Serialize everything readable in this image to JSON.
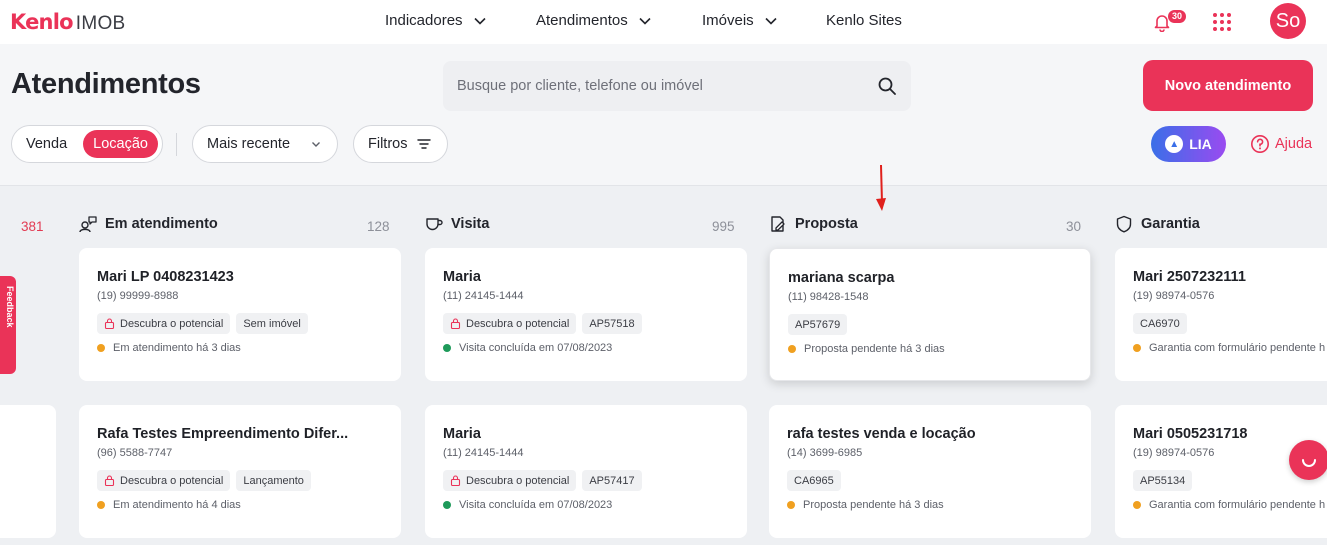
{
  "brand": {
    "name": "Kenlo",
    "product": "IMOB",
    "accent": "#ea3358"
  },
  "nav": [
    {
      "label": "Indicadores",
      "has_dropdown": true
    },
    {
      "label": "Atendimentos",
      "has_dropdown": true
    },
    {
      "label": "Imóveis",
      "has_dropdown": true
    },
    {
      "label": "Kenlo Sites",
      "has_dropdown": false
    }
  ],
  "notifications": {
    "icon": "bell-icon",
    "count": "30"
  },
  "apps_icon": "grid-dots-icon",
  "user": {
    "initials": "So"
  },
  "page": {
    "title": "Atendimentos",
    "search_placeholder": "Busque por cliente, telefone ou imóvel",
    "search_value": "",
    "new_button": "Novo atendimento"
  },
  "filters": {
    "segment": [
      {
        "label": "Venda",
        "active": false
      },
      {
        "label": "Locação",
        "active": true
      }
    ],
    "sort": "Mais recente",
    "filters_label": "Filtros",
    "lia_label": "LIA",
    "help_label": "Ajuda"
  },
  "side_tab": {
    "label": "Feedback"
  },
  "board": {
    "prev_count": "381",
    "columns": [
      {
        "title": "Em atendimento",
        "count": "128",
        "icon": "users-chat-icon",
        "cards": [
          {
            "name": "Mari LP 0408231423",
            "phone": "(19) 99999-8988",
            "tags": [
              {
                "label": "Descubra o potencial",
                "icon": "lock-icon"
              },
              {
                "label": "Sem imóvel"
              }
            ],
            "status": "Em atendimento há 3 dias",
            "status_color": "#f0a020"
          },
          {
            "name": "Rafa Testes Empreendimento Difer...",
            "phone": "(96) 5588-7747",
            "tags": [
              {
                "label": "Descubra o potencial",
                "icon": "lock-icon"
              },
              {
                "label": "Lançamento"
              }
            ],
            "status": "Em atendimento há 4 dias",
            "status_color": "#f0a020"
          }
        ]
      },
      {
        "title": "Visita",
        "count": "995",
        "icon": "mug-icon",
        "cards": [
          {
            "name": "Maria",
            "phone": "(11) 24145-1444",
            "tags": [
              {
                "label": "Descubra o potencial",
                "icon": "lock-icon"
              },
              {
                "label": "AP57518"
              }
            ],
            "status": "Visita concluída em 07/08/2023",
            "status_color": "#1e9a5a"
          },
          {
            "name": "Maria",
            "phone": "(11) 24145-1444",
            "tags": [
              {
                "label": "Descubra o potencial",
                "icon": "lock-icon"
              },
              {
                "label": "AP57417"
              }
            ],
            "status": "Visita concluída em 07/08/2023",
            "status_color": "#1e9a5a"
          }
        ]
      },
      {
        "title": "Proposta",
        "count": "30",
        "icon": "document-pen-icon",
        "cards": [
          {
            "name": "mariana scarpa",
            "phone": "(11) 98428-1548",
            "tags": [
              {
                "label": "AP57679"
              }
            ],
            "status": "Proposta pendente há 3 dias",
            "status_color": "#f0a020"
          },
          {
            "name": "rafa testes venda e locação",
            "phone": "(14) 3699-6985",
            "tags": [
              {
                "label": "CA6965"
              }
            ],
            "status": "Proposta pendente há 3 dias",
            "status_color": "#f0a020"
          }
        ]
      },
      {
        "title": "Garantia",
        "count": "",
        "icon": "shield-icon",
        "cards": [
          {
            "name": "Mari 2507232111",
            "phone": "(19) 98974-0576",
            "tags": [
              {
                "label": "CA6970"
              }
            ],
            "status": "Garantia com formulário pendente h",
            "status_color": "#f0a020"
          },
          {
            "name": "Mari 0505231718",
            "phone": "(19) 98974-0576",
            "tags": [
              {
                "label": "AP55134"
              }
            ],
            "status": "Garantia com formulário pendente h",
            "status_color": "#f0a020"
          }
        ]
      }
    ]
  }
}
